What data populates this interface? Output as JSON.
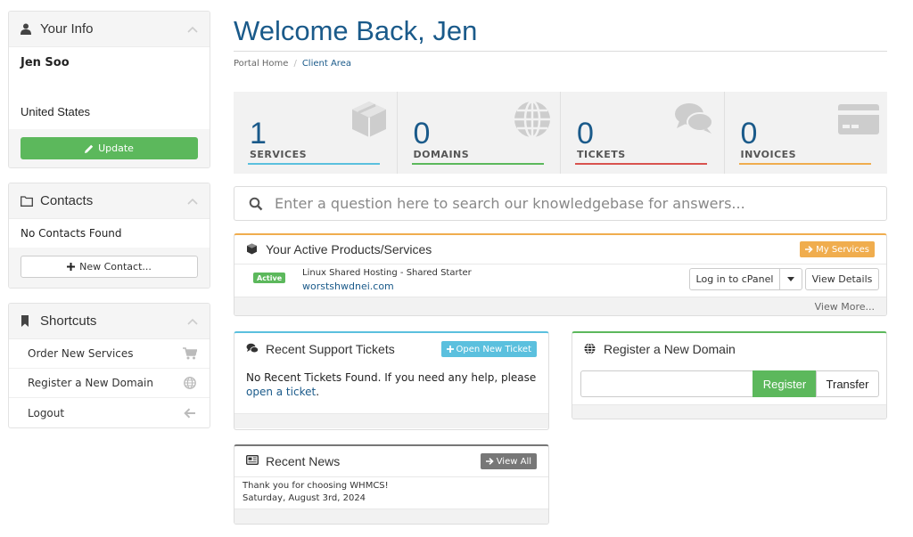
{
  "your_info": {
    "title": "Your Info",
    "name": "Jen Soo",
    "country": "United States",
    "update_label": "Update"
  },
  "contacts": {
    "title": "Contacts",
    "empty_text": "No Contacts Found",
    "new_contact_label": "New Contact..."
  },
  "shortcuts": {
    "title": "Shortcuts",
    "items": [
      {
        "label": "Order New Services",
        "icon": "cart-icon"
      },
      {
        "label": "Register a New Domain",
        "icon": "globe-icon"
      },
      {
        "label": "Logout",
        "icon": "arrow-left-icon"
      }
    ]
  },
  "header": {
    "title": "Welcome Back, Jen",
    "breadcrumb": [
      "Portal Home",
      "/",
      "Client Area"
    ]
  },
  "tiles": [
    {
      "value": "1",
      "label": "SERVICES",
      "color": "#5bc0de",
      "icon": "cube-icon"
    },
    {
      "value": "0",
      "label": "DOMAINS",
      "color": "#5cb85c",
      "icon": "globe-icon"
    },
    {
      "value": "0",
      "label": "TICKETS",
      "color": "#d9534f",
      "icon": "comments-icon"
    },
    {
      "value": "0",
      "label": "INVOICES",
      "color": "#f0ad4e",
      "icon": "credit-card-icon"
    }
  ],
  "kb_search": {
    "placeholder": "Enter a question here to search our knowledgebase for answers..."
  },
  "products": {
    "title": "Your Active Products/Services",
    "my_services_label": "My Services",
    "accent": "#f0ad4e",
    "item": {
      "status": "Active",
      "name": "Linux Shared Hosting - Shared Starter",
      "domain": "worstshwdnei.com",
      "login_label": "Log in to cPanel",
      "view_details_label": "View Details"
    },
    "view_more_label": "View More..."
  },
  "tickets": {
    "title": "Recent Support Tickets",
    "open_ticket_label": "Open New Ticket",
    "accent": "#5bc0de",
    "text_before": "No Recent Tickets Found. If you need any help, please",
    "link_text": "open a ticket",
    "text_after": "."
  },
  "domain_register": {
    "title": "Register a New Domain",
    "register_label": "Register",
    "transfer_label": "Transfer",
    "input_value": "",
    "accent": "#5cb85c"
  },
  "news": {
    "title": "Recent News",
    "view_all_label": "View All",
    "accent": "#777777",
    "headline": "Thank you for choosing WHMCS!",
    "date": "Saturday, August 3rd, 2024"
  }
}
